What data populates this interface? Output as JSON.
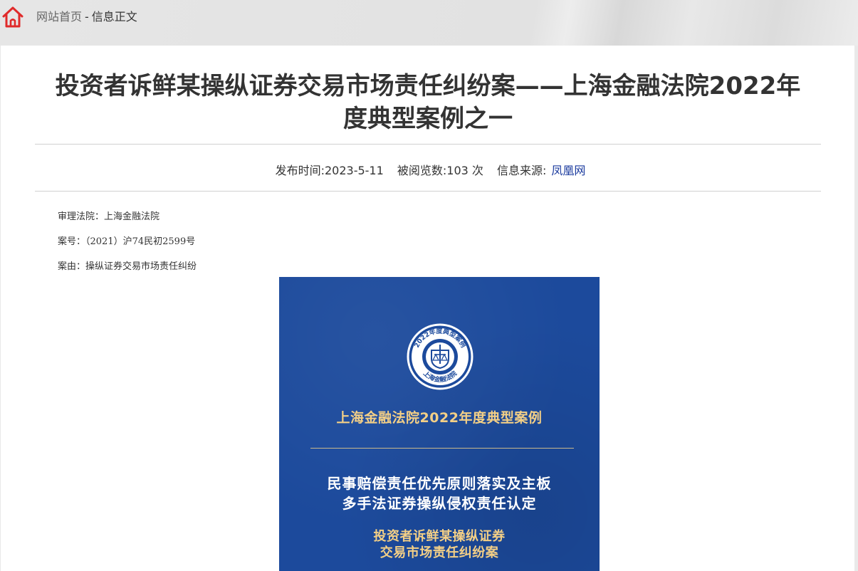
{
  "breadcrumb": {
    "home": "网站首页",
    "separator": "-",
    "current": "信息正文"
  },
  "article": {
    "title_line1": "投资者诉鲜某操纵证券交易市场责任纠纷案——上海金融法院2022年",
    "title_line2": "度典型案例之一",
    "publish": "发布时间:2023-5-11",
    "views": "被阅览数:103 次",
    "source_label": "信息来源:",
    "source_name": "凤凰网",
    "court": "审理法院：上海金融法院",
    "case_no": "案号：（2021）沪74民初2599号",
    "cause": "案由：操纵证券交易市场责任纠纷"
  },
  "poster": {
    "badge_ring_text": "2022年度典型案例",
    "badge_bottom_text": "上海金融法院",
    "title": "上海金融法院2022年度典型案例",
    "subtitle_line1": "民事赔偿责任优先原则落实及主板",
    "subtitle_line2": "多手法证券操纵侵权责任认定",
    "case_line1": "投资者诉鲜某操纵证券",
    "case_line2": "交易市场责任纠纷案",
    "colors": {
      "background": "#1c4a9c",
      "gold": "#f3cf86"
    }
  },
  "colors": {
    "home_icon": "#e02a2a",
    "link": "#1a3a9e"
  }
}
